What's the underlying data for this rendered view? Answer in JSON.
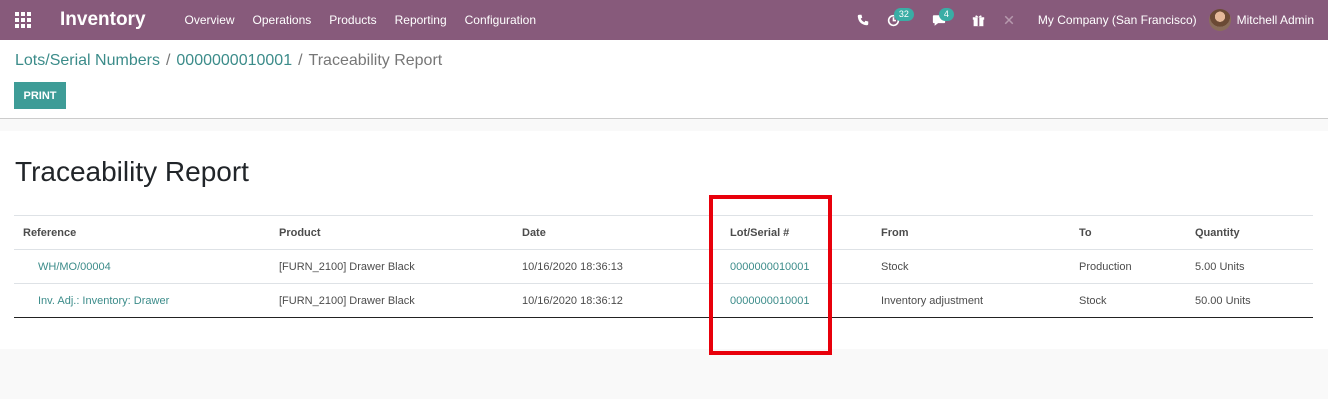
{
  "navbar": {
    "app_title": "Inventory",
    "menu": [
      "Overview",
      "Operations",
      "Products",
      "Reporting",
      "Configuration"
    ],
    "activities_count": "32",
    "messages_count": "4",
    "company": "My Company (San Francisco)",
    "user": "Mitchell Admin",
    "color": "#875a7b"
  },
  "breadcrumb": {
    "root": "Lots/Serial Numbers",
    "lot": "0000000010001",
    "current": "Traceability Report",
    "separator": "/"
  },
  "buttons": {
    "print": "PRINT"
  },
  "report": {
    "title": "Traceability Report",
    "columns": [
      "Reference",
      "Product",
      "Date",
      "Lot/Serial #",
      "From",
      "To",
      "Quantity"
    ],
    "rows": [
      {
        "reference": "WH/MO/00004",
        "product": "[FURN_2100] Drawer Black",
        "date": "10/16/2020 18:36:13",
        "lot": "0000000010001",
        "from": "Stock",
        "to": "Production",
        "quantity": "5.00 Units"
      },
      {
        "reference": "Inv. Adj.: Inventory: Drawer",
        "product": "[FURN_2100] Drawer Black",
        "date": "10/16/2020 18:36:12",
        "lot": "0000000010001",
        "from": "Inventory adjustment",
        "to": "Stock",
        "quantity": "50.00 Units"
      }
    ]
  },
  "icons": {
    "apps": "apps-grid-icon",
    "phone": "phone-icon",
    "activity": "clock-icon",
    "messages": "chat-icon",
    "gift": "gift-icon",
    "debug": "bug-icon"
  },
  "accent_color": "#3c8c8a",
  "highlight_color": "#e8000b"
}
